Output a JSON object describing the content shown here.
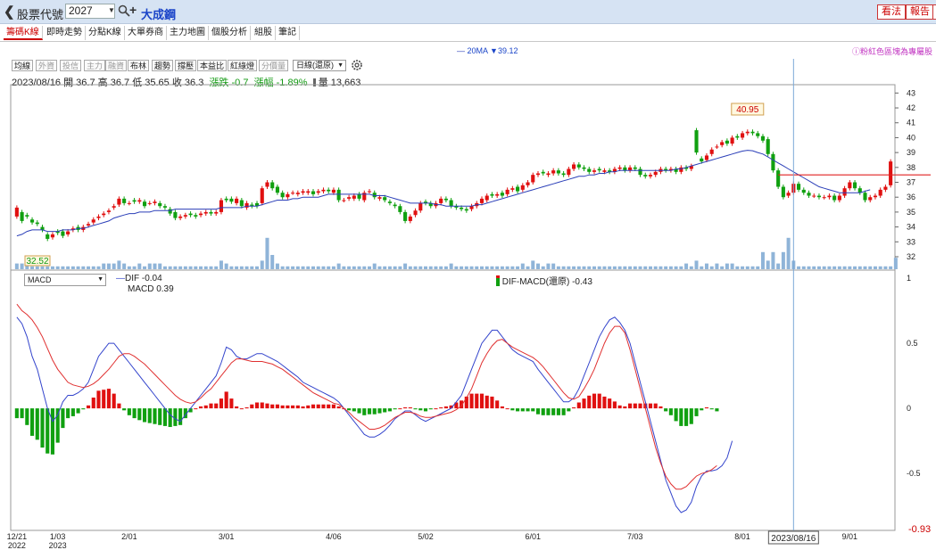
{
  "header": {
    "code_label": "股票代號",
    "code_value": "2027",
    "stock_name": "大成鋼",
    "btn_view": "看法",
    "btn_report": "報告"
  },
  "tabs": [
    "籌碼K線",
    "即時走勢",
    "分點K線",
    "大單券商",
    "主力地圖",
    "個股分析",
    "組股",
    "筆記"
  ],
  "ma_legend": "20MA ▼39.12",
  "promo": "ⓘ粉紅色區塊為專屬股",
  "toolbar": {
    "items": [
      "均線",
      "外資",
      "投信",
      "主力",
      "融資",
      "布林",
      "趨勢",
      "撐壓",
      "本益比",
      "紅綠燈",
      "分價量"
    ],
    "dim": [
      false,
      true,
      true,
      true,
      true,
      false,
      false,
      false,
      false,
      false,
      true
    ],
    "period": "日線(還原)"
  },
  "ohlc": {
    "date": "2023/08/16",
    "open": "開 36.7",
    "high": "高 36.7",
    "low": "低 35.65",
    "close": "收 36.3",
    "change": "漲跌 -0.7",
    "pct": "漲幅 -1.89%",
    "vol": "量 13,663"
  },
  "macd": {
    "selector": "MACD",
    "dif": "DIF -0.04",
    "macd": "MACD 0.39",
    "osc": "DIF-MACD(還原) -0.43"
  },
  "colors": {
    "up": "#e01010",
    "down": "#10a010",
    "ma": "#2b3fb8",
    "dif": "#3344cc",
    "macd_line": "#e03030",
    "vol": "#8fb4d8"
  },
  "chart_data": {
    "type": "candlestick",
    "price_axis": {
      "ticks": [
        32,
        33,
        34,
        35,
        36,
        37,
        38,
        39,
        40,
        41,
        42,
        43
      ],
      "range": [
        31.4,
        43.5
      ]
    },
    "annot_high": "40.95",
    "annot_low": "32.52",
    "hline": 37.5,
    "macd_axis": {
      "ticks": [
        "1",
        "0.5",
        "0",
        "-0.5"
      ],
      "bottom": "-0.93",
      "range": [
        -0.93,
        1
      ]
    },
    "x_ticks": [
      {
        "label": "12/21",
        "sub": "2022",
        "i": 0
      },
      {
        "label": "1/03",
        "sub": "2023",
        "i": 8
      },
      {
        "label": "2/01",
        "i": 22
      },
      {
        "label": "3/01",
        "i": 41
      },
      {
        "label": "4/06",
        "i": 62
      },
      {
        "label": "5/02",
        "i": 80
      },
      {
        "label": "6/01",
        "i": 101
      },
      {
        "label": "7/03",
        "i": 121
      },
      {
        "label": "8/01",
        "i": 142
      },
      {
        "label": "2023/08/16",
        "i": 152
      },
      {
        "label": "9/01",
        "i": 163
      }
    ],
    "close": [
      35.3,
      34.4,
      34.7,
      34.3,
      34.2,
      33.8,
      33.2,
      33.5,
      33.6,
      33.4,
      33.7,
      33.9,
      33.8,
      34.0,
      34.2,
      34.5,
      34.7,
      34.9,
      35.1,
      35.4,
      35.9,
      35.6,
      35.6,
      35.7,
      35.8,
      35.4,
      35.6,
      35.7,
      35.4,
      35.3,
      34.9,
      34.6,
      34.7,
      34.8,
      34.8,
      34.7,
      34.9,
      35.0,
      34.9,
      35.0,
      35.8,
      35.8,
      35.7,
      35.9,
      35.4,
      35.6,
      35.4,
      35.4,
      36.6,
      37.0,
      36.6,
      36.3,
      36.0,
      36.2,
      36.3,
      36.3,
      36.4,
      36.4,
      36.2,
      36.4,
      36.5,
      36.4,
      36.5,
      35.8,
      35.8,
      36.0,
      36.1,
      35.9,
      36.3,
      36.4,
      36.0,
      36.0,
      35.8,
      35.6,
      35.4,
      35.0,
      34.4,
      34.7,
      35.1,
      35.6,
      35.6,
      35.4,
      35.6,
      35.9,
      35.8,
      35.4,
      35.3,
      35.2,
      35.1,
      35.4,
      35.6,
      35.9,
      36.1,
      36.1,
      36.2,
      36.1,
      36.5,
      36.6,
      36.4,
      36.8,
      37.0,
      37.5,
      37.6,
      37.6,
      37.6,
      37.8,
      37.6,
      37.5,
      37.9,
      38.2,
      38.0,
      37.9,
      37.7,
      37.8,
      37.8,
      37.8,
      37.7,
      37.9,
      38.0,
      37.8,
      38.0,
      37.9,
      37.5,
      37.4,
      37.5,
      37.7,
      37.9,
      37.8,
      37.9,
      37.7,
      38.0,
      37.9,
      38.1,
      39.0,
      38.4,
      38.8,
      39.2,
      39.4,
      39.7,
      39.6,
      40.0,
      40.0,
      40.3,
      40.4,
      40.3,
      40.1,
      39.8,
      38.9,
      37.8,
      36.7,
      36.0,
      36.3,
      36.9,
      36.5,
      36.3,
      36.1,
      36.1,
      36.0,
      36.0,
      36.1,
      35.8,
      36.1,
      36.6,
      37.0,
      36.6,
      36.3,
      35.8,
      36.0,
      36.1,
      36.5,
      36.7,
      38.4
    ],
    "open": [
      34.7,
      35.0,
      34.8,
      34.5,
      34.3,
      34.0,
      33.5,
      33.3,
      33.7,
      33.7,
      33.5,
      33.8,
      34.0,
      33.8,
      34.1,
      34.3,
      34.6,
      34.8,
      35.0,
      35.3,
      35.5,
      35.9,
      35.6,
      35.8,
      35.7,
      35.7,
      35.6,
      35.6,
      35.6,
      35.4,
      35.2,
      35.0,
      34.6,
      34.7,
      34.9,
      34.8,
      34.8,
      34.9,
      35.0,
      34.9,
      35.0,
      35.9,
      35.9,
      35.6,
      35.8,
      35.3,
      35.5,
      35.6,
      35.6,
      36.7,
      37.0,
      36.7,
      36.3,
      36.0,
      36.3,
      36.2,
      36.3,
      36.3,
      36.4,
      36.3,
      36.4,
      36.5,
      36.3,
      36.5,
      35.8,
      35.9,
      35.9,
      36.2,
      35.8,
      36.4,
      36.3,
      35.9,
      36.0,
      35.7,
      35.5,
      35.4,
      35.0,
      34.4,
      34.8,
      35.1,
      35.7,
      35.6,
      35.4,
      35.6,
      35.9,
      35.8,
      35.4,
      35.3,
      35.2,
      35.2,
      35.4,
      35.6,
      35.8,
      36.2,
      36.1,
      36.3,
      36.2,
      36.5,
      36.7,
      36.5,
      36.8,
      37.0,
      37.5,
      37.7,
      37.5,
      37.6,
      37.8,
      37.6,
      37.5,
      37.9,
      38.2,
      38.0,
      37.9,
      37.7,
      37.9,
      37.7,
      37.8,
      37.7,
      37.9,
      38.0,
      37.8,
      38.0,
      37.9,
      37.5,
      37.4,
      37.5,
      37.7,
      37.9,
      37.8,
      37.9,
      37.7,
      38.0,
      37.9,
      40.5,
      38.6,
      38.5,
      38.9,
      39.4,
      39.5,
      39.8,
      39.6,
      40.1,
      40.0,
      40.3,
      40.4,
      40.3,
      40.1,
      39.9,
      38.9,
      37.8,
      36.7,
      36.1,
      36.3,
      36.9,
      36.5,
      36.3,
      36.1,
      36.1,
      36.0,
      36.0,
      36.1,
      35.8,
      36.1,
      36.6,
      37.0,
      36.6,
      36.3,
      35.8,
      36.0,
      36.1,
      36.5,
      36.8
    ],
    "volume": [
      2,
      2,
      3,
      1,
      1,
      1,
      1,
      1,
      1,
      1,
      1,
      1,
      1,
      1,
      1,
      1,
      1,
      2,
      2,
      2,
      3,
      2,
      1,
      1,
      2,
      1,
      2,
      2,
      2,
      1,
      1,
      1,
      1,
      1,
      1,
      1,
      1,
      1,
      1,
      1,
      3,
      2,
      1,
      1,
      1,
      1,
      1,
      1,
      3,
      11,
      5,
      2,
      1,
      1,
      1,
      1,
      1,
      1,
      1,
      1,
      1,
      1,
      1,
      2,
      1,
      1,
      1,
      1,
      1,
      1,
      2,
      1,
      1,
      1,
      1,
      1,
      2,
      1,
      1,
      1,
      1,
      1,
      1,
      1,
      1,
      2,
      1,
      1,
      1,
      1,
      1,
      1,
      1,
      1,
      1,
      1,
      1,
      1,
      1,
      2,
      1,
      3,
      2,
      1,
      2,
      2,
      1,
      1,
      1,
      1,
      1,
      1,
      1,
      1,
      1,
      1,
      1,
      1,
      1,
      1,
      1,
      1,
      1,
      1,
      1,
      1,
      1,
      1,
      1,
      1,
      1,
      2,
      1,
      3,
      1,
      2,
      1,
      2,
      1,
      2,
      2,
      1,
      1,
      1,
      1,
      1,
      6,
      3,
      6,
      2,
      6,
      11,
      3,
      1,
      1,
      1,
      1,
      1,
      1,
      1,
      1,
      1,
      1,
      1,
      1,
      1,
      1,
      1,
      1,
      1,
      1,
      1,
      4
    ],
    "ma20": [
      33.4,
      33.5,
      33.7,
      33.8,
      33.8,
      33.8,
      33.7,
      33.7,
      33.7,
      33.8,
      33.8,
      33.8,
      33.9,
      33.9,
      34.0,
      34.1,
      34.2,
      34.3,
      34.4,
      34.6,
      34.7,
      34.8,
      34.9,
      34.9,
      35.0,
      35.0,
      35.0,
      35.1,
      35.1,
      35.1,
      35.1,
      35.2,
      35.2,
      35.2,
      35.2,
      35.2,
      35.2,
      35.2,
      35.2,
      35.2,
      35.3,
      35.3,
      35.3,
      35.3,
      35.3,
      35.4,
      35.4,
      35.4,
      35.5,
      35.6,
      35.7,
      35.8,
      35.8,
      35.8,
      35.9,
      35.9,
      36.0,
      36.0,
      36.0,
      36.0,
      36.1,
      36.2,
      36.2,
      36.2,
      36.2,
      36.2,
      36.2,
      36.2,
      36.2,
      36.2,
      36.1,
      36.1,
      36.1,
      36.0,
      35.9,
      35.8,
      35.7,
      35.6,
      35.6,
      35.6,
      35.6,
      35.6,
      35.5,
      35.5,
      35.4,
      35.4,
      35.4,
      35.4,
      35.4,
      35.4,
      35.5,
      35.5,
      35.6,
      35.7,
      35.8,
      35.9,
      36.0,
      36.1,
      36.2,
      36.3,
      36.4,
      36.5,
      36.6,
      36.7,
      36.8,
      36.9,
      37.0,
      37.1,
      37.2,
      37.3,
      37.4,
      37.4,
      37.5,
      37.5,
      37.6,
      37.6,
      37.7,
      37.7,
      37.8,
      37.8,
      37.8,
      37.8,
      37.8,
      37.8,
      37.8,
      37.8,
      37.8,
      37.8,
      37.8,
      37.9,
      37.9,
      38.0,
      38.1,
      38.2,
      38.3,
      38.4,
      38.5,
      38.6,
      38.7,
      38.8,
      38.9,
      39.0,
      39.1,
      39.15,
      39.12,
      39.0,
      38.9,
      38.7,
      38.5,
      38.3,
      38.1,
      37.9,
      37.7,
      37.5,
      37.3,
      37.1,
      36.9,
      36.7,
      36.6,
      36.5,
      36.4,
      36.3,
      36.3,
      36.3,
      36.3,
      36.3,
      36.4,
      36.5
    ],
    "dif": [
      0.7,
      0.65,
      0.55,
      0.4,
      0.3,
      0.15,
      0.0,
      -0.1,
      -0.05,
      0.05,
      0.1,
      0.1,
      0.12,
      0.15,
      0.2,
      0.3,
      0.4,
      0.45,
      0.5,
      0.5,
      0.45,
      0.4,
      0.35,
      0.3,
      0.25,
      0.2,
      0.15,
      0.1,
      0.05,
      0.0,
      -0.05,
      -0.08,
      -0.1,
      -0.05,
      0.0,
      0.05,
      0.1,
      0.15,
      0.2,
      0.25,
      0.35,
      0.47,
      0.45,
      0.4,
      0.38,
      0.38,
      0.4,
      0.42,
      0.42,
      0.4,
      0.38,
      0.36,
      0.33,
      0.3,
      0.27,
      0.24,
      0.2,
      0.18,
      0.16,
      0.14,
      0.12,
      0.1,
      0.08,
      0.05,
      0.0,
      -0.05,
      -0.1,
      -0.15,
      -0.2,
      -0.22,
      -0.22,
      -0.2,
      -0.17,
      -0.13,
      -0.08,
      -0.05,
      -0.02,
      -0.02,
      -0.05,
      -0.08,
      -0.1,
      -0.08,
      -0.06,
      -0.04,
      -0.02,
      0.0,
      0.05,
      0.1,
      0.2,
      0.3,
      0.4,
      0.5,
      0.55,
      0.6,
      0.6,
      0.55,
      0.5,
      0.45,
      0.42,
      0.4,
      0.38,
      0.36,
      0.3,
      0.25,
      0.2,
      0.15,
      0.1,
      0.05,
      0.05,
      0.08,
      0.15,
      0.25,
      0.35,
      0.45,
      0.55,
      0.62,
      0.68,
      0.7,
      0.66,
      0.6,
      0.5,
      0.35,
      0.2,
      0.05,
      -0.1,
      -0.25,
      -0.4,
      -0.55,
      -0.65,
      -0.75,
      -0.8,
      -0.78,
      -0.72,
      -0.6,
      -0.52,
      -0.48,
      -0.48,
      -0.47,
      -0.44,
      -0.38,
      -0.25
    ],
    "macd_line": [
      0.8,
      0.75,
      0.72,
      0.68,
      0.62,
      0.55,
      0.46,
      0.37,
      0.3,
      0.25,
      0.2,
      0.18,
      0.17,
      0.16,
      0.17,
      0.19,
      0.22,
      0.26,
      0.3,
      0.35,
      0.4,
      0.42,
      0.42,
      0.4,
      0.37,
      0.34,
      0.3,
      0.26,
      0.22,
      0.18,
      0.14,
      0.1,
      0.07,
      0.05,
      0.04,
      0.05,
      0.08,
      0.12,
      0.15,
      0.2,
      0.25,
      0.3,
      0.35,
      0.38,
      0.38,
      0.37,
      0.36,
      0.36,
      0.36,
      0.35,
      0.34,
      0.32,
      0.3,
      0.27,
      0.24,
      0.21,
      0.18,
      0.15,
      0.12,
      0.1,
      0.08,
      0.06,
      0.04,
      0.03,
      0.0,
      -0.03,
      -0.07,
      -0.1,
      -0.13,
      -0.16,
      -0.16,
      -0.15,
      -0.13,
      -0.1,
      -0.07,
      -0.05,
      -0.03,
      -0.03,
      -0.04,
      -0.06,
      -0.07,
      -0.07,
      -0.06,
      -0.05,
      -0.04,
      -0.03,
      -0.01,
      0.02,
      0.08,
      0.15,
      0.25,
      0.35,
      0.42,
      0.48,
      0.52,
      0.53,
      0.5,
      0.47,
      0.45,
      0.43,
      0.41,
      0.39,
      0.36,
      0.32,
      0.27,
      0.22,
      0.17,
      0.12,
      0.08,
      0.07,
      0.09,
      0.15,
      0.22,
      0.3,
      0.4,
      0.5,
      0.58,
      0.63,
      0.63,
      0.58,
      0.45,
      0.3,
      0.15,
      0.0,
      -0.15,
      -0.3,
      -0.42,
      -0.52,
      -0.58,
      -0.62,
      -0.62,
      -0.6,
      -0.56,
      -0.52,
      -0.5,
      -0.49,
      -0.47,
      -0.44
    ]
  }
}
